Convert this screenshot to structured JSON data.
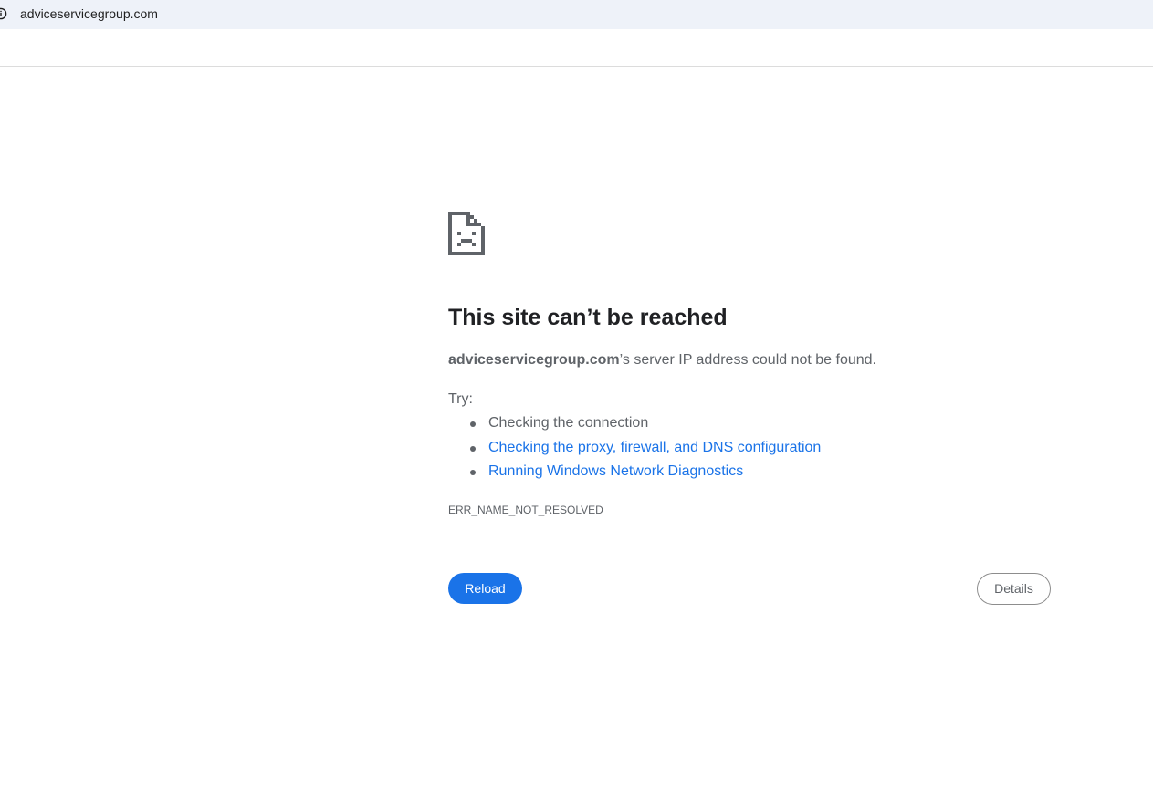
{
  "addressbar": {
    "url": "adviceservicegroup.com",
    "icon": "info-icon"
  },
  "error": {
    "icon": "sad-page-icon",
    "title": "This site can’t be reached",
    "summary_host": "adviceservicegroup.com",
    "summary_rest": "’s server IP address could not be found.",
    "try_label": "Try:",
    "suggestions": [
      {
        "label": "Checking the connection",
        "link": false
      },
      {
        "label": "Checking the proxy, firewall, and DNS configuration",
        "link": true
      },
      {
        "label": "Running Windows Network Diagnostics",
        "link": true
      }
    ],
    "code": "ERR_NAME_NOT_RESOLVED"
  },
  "buttons": {
    "reload_label": "Reload",
    "details_label": "Details"
  },
  "colors": {
    "accent": "#1a73e8",
    "text_secondary": "#5f6368",
    "text_primary": "#202124",
    "addressbar_bg": "#eef2f9"
  }
}
